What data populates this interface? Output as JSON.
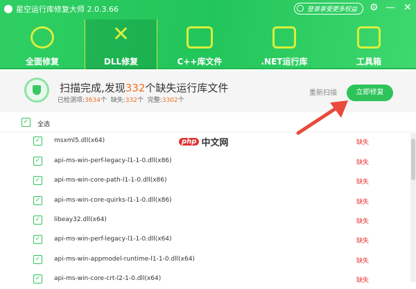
{
  "window": {
    "title": "星空运行库修复大师 2.0.3.66",
    "login": "登录享受更多权益"
  },
  "nav": [
    {
      "label": "全面修复"
    },
    {
      "label": "DLL修复"
    },
    {
      "label": "C++库文件"
    },
    {
      "label": ".NET运行库"
    },
    {
      "label": "工具箱"
    }
  ],
  "summary": {
    "prefix": "扫描完成,发现",
    "count": "332",
    "suffix": "个缺失运行库文件",
    "checked_label": "已检测项:",
    "checked": "3634",
    "unit": "个",
    "missing_label": "缺失:",
    "missing": "332",
    "ok_label": "完整:",
    "ok": "3302",
    "rescan": "重新扫描",
    "fix": "立即修复"
  },
  "select_all": "全选",
  "files": [
    {
      "name": "msxml5.dll(x64)",
      "status": "缺失"
    },
    {
      "name": "api-ms-win-perf-legacy-l1-1-0.dll(x86)",
      "status": "缺失"
    },
    {
      "name": "api-ms-win-core-path-l1-1-0.dll(x86)",
      "status": "缺失"
    },
    {
      "name": "api-ms-win-core-quirks-l1-1-0.dll(x86)",
      "status": "缺失"
    },
    {
      "name": "libeay32.dll(x64)",
      "status": "缺失"
    },
    {
      "name": "api-ms-win-perf-legacy-l1-1-0.dll(x64)",
      "status": "缺失"
    },
    {
      "name": "api-ms-win-appmodel-runtime-l1-1-0.dll(x64)",
      "status": "缺失"
    },
    {
      "name": "api-ms-win-core-crt-l2-1-0.dll(x64)",
      "status": "缺失"
    }
  ],
  "watermark": {
    "badge": "php",
    "text": "中文网"
  }
}
